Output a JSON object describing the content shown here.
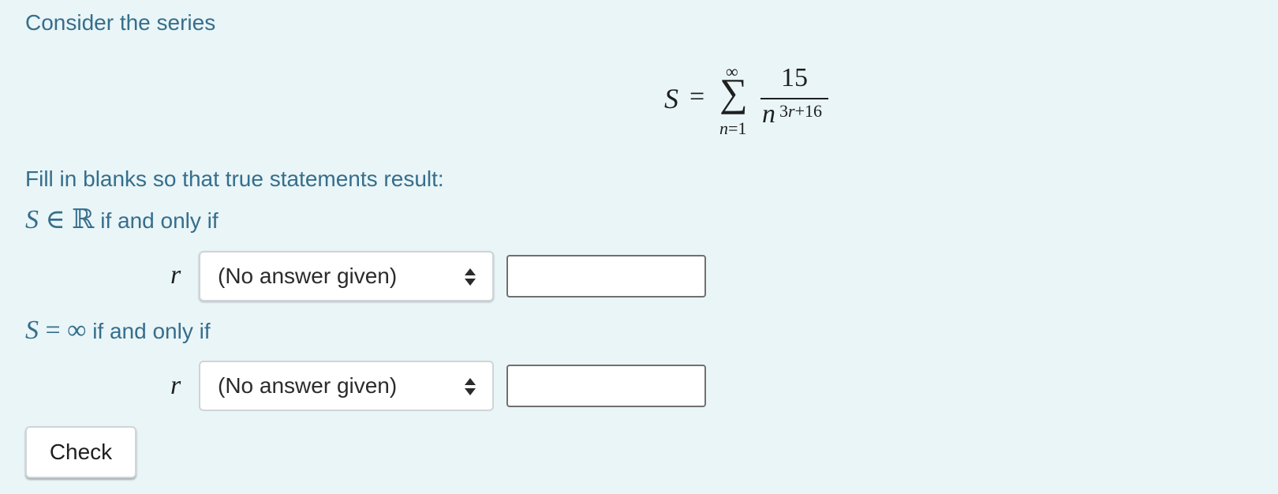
{
  "intro": "Consider the series",
  "formula": {
    "lhs": "S",
    "equals": "=",
    "sum_symbol": "∑",
    "upper_limit": "∞",
    "lower_var": "n",
    "lower_rest": "=1",
    "numerator": "15",
    "denominator_base": "n",
    "exponent_first": "3",
    "exponent_var": "r",
    "exponent_rest": "+16"
  },
  "instruction": "Fill in blanks so that true statements result:",
  "conditions": [
    {
      "lhs": "S",
      "operator": " ∈ ℝ",
      "text": " if and only if",
      "variable": "r",
      "select_value": "(No answer given)",
      "input_value": ""
    },
    {
      "lhs": "S",
      "operator": " = ∞",
      "text": " if and only if",
      "variable": "r",
      "select_value": "(No answer given)",
      "input_value": ""
    }
  ],
  "check_button_label": "Check",
  "colors": {
    "background": "#e9f5f7",
    "text": "#366e8c"
  }
}
